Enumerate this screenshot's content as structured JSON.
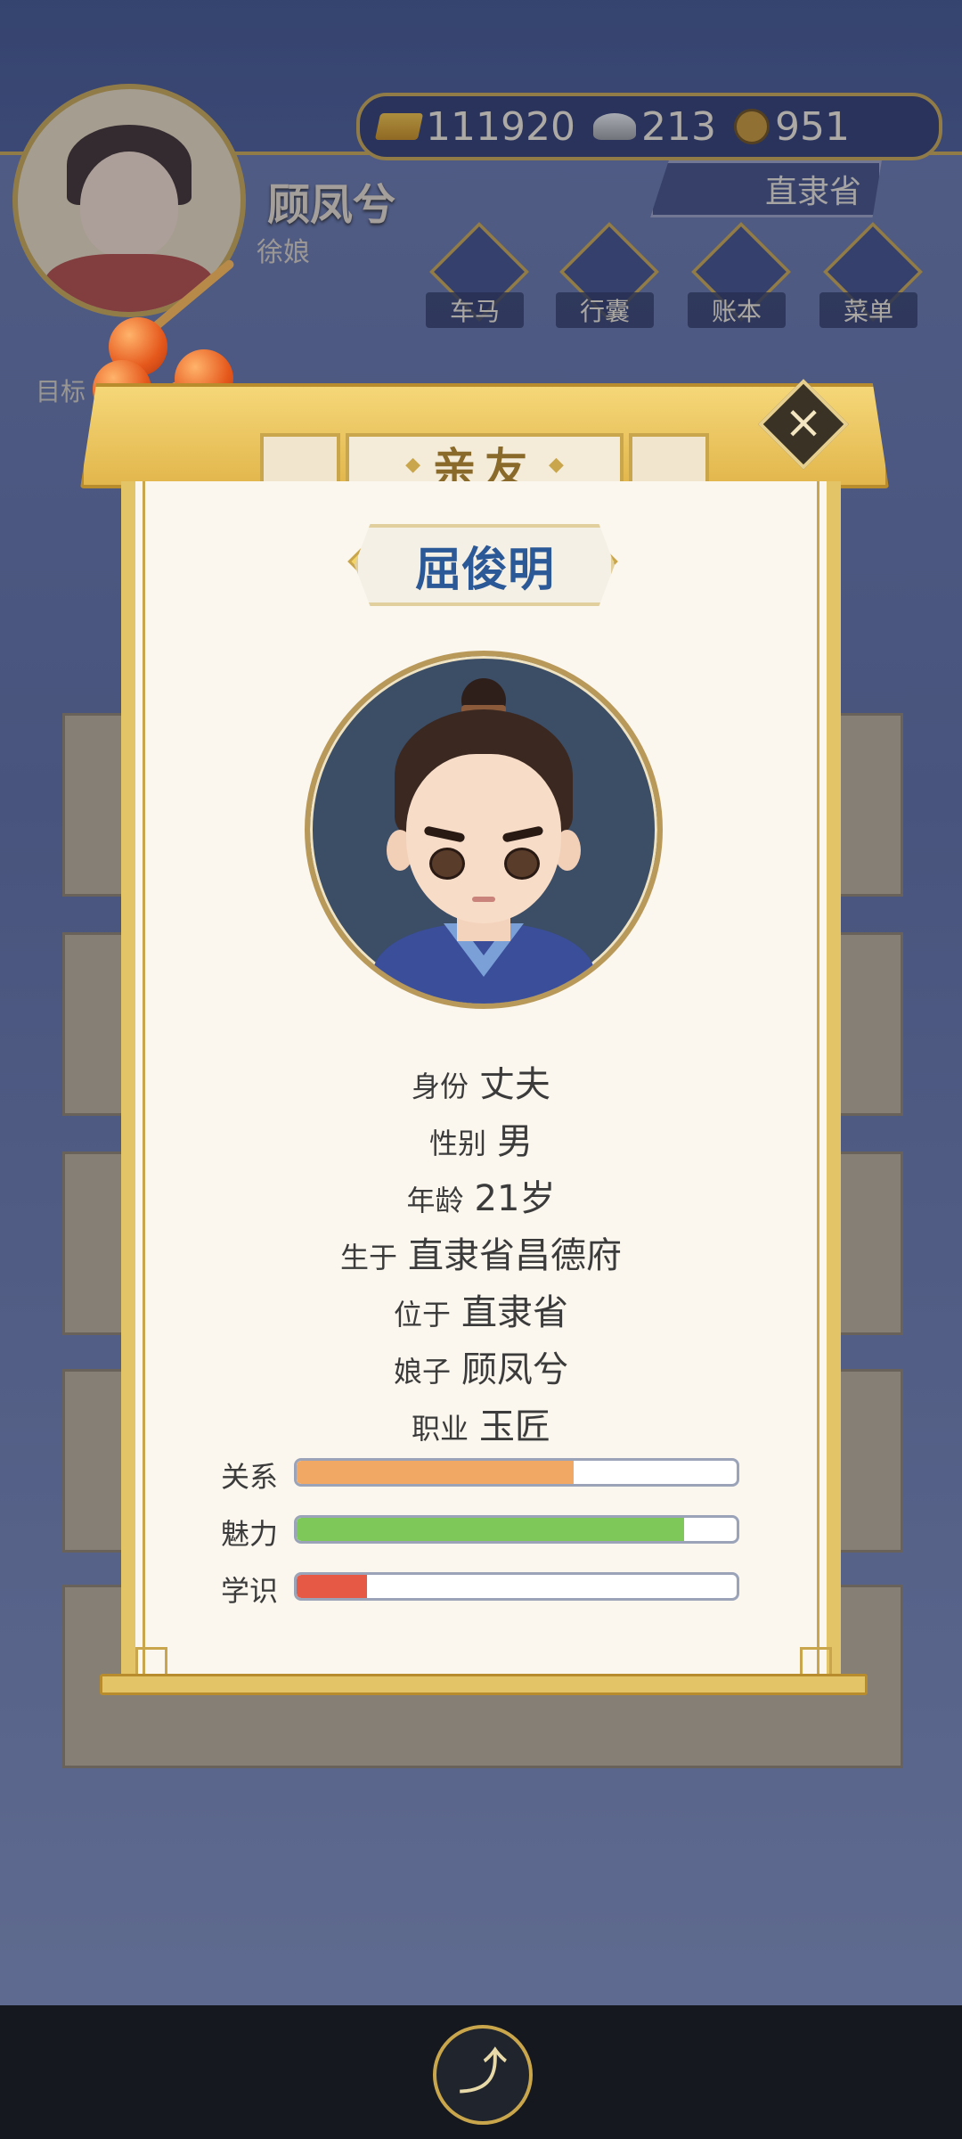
{
  "player": {
    "name": "顾凤兮",
    "title": "徐娘"
  },
  "currency": {
    "gold": "111920",
    "silver": "213",
    "coins": "951"
  },
  "location": "直隶省",
  "menu": [
    {
      "label": "车马",
      "icon": "carriage-icon"
    },
    {
      "label": "行囊",
      "icon": "bag-icon"
    },
    {
      "label": "账本",
      "icon": "ledger-icon"
    },
    {
      "label": "菜单",
      "icon": "more-icon"
    }
  ],
  "goal_label": "目标",
  "modal": {
    "title": "亲友",
    "name": "屈俊明",
    "info": [
      {
        "key": "身份",
        "value": "丈夫"
      },
      {
        "key": "性别",
        "value": "男"
      },
      {
        "key": "年龄",
        "value": "21岁"
      },
      {
        "key": "生于",
        "value": "直隶省昌德府"
      },
      {
        "key": "位于",
        "value": "直隶省"
      },
      {
        "key": "娘子",
        "value": "顾凤兮"
      },
      {
        "key": "职业",
        "value": "玉匠"
      }
    ],
    "stats": [
      {
        "label": "关系",
        "value": 0.63,
        "color": "#f2a865"
      },
      {
        "label": "魅力",
        "value": 0.88,
        "color": "#7dc859"
      },
      {
        "label": "学识",
        "value": 0.16,
        "color": "#e65a45"
      }
    ]
  },
  "colors": {
    "accent_gold": "#c9a64b",
    "name_blue": "#2b5896"
  }
}
